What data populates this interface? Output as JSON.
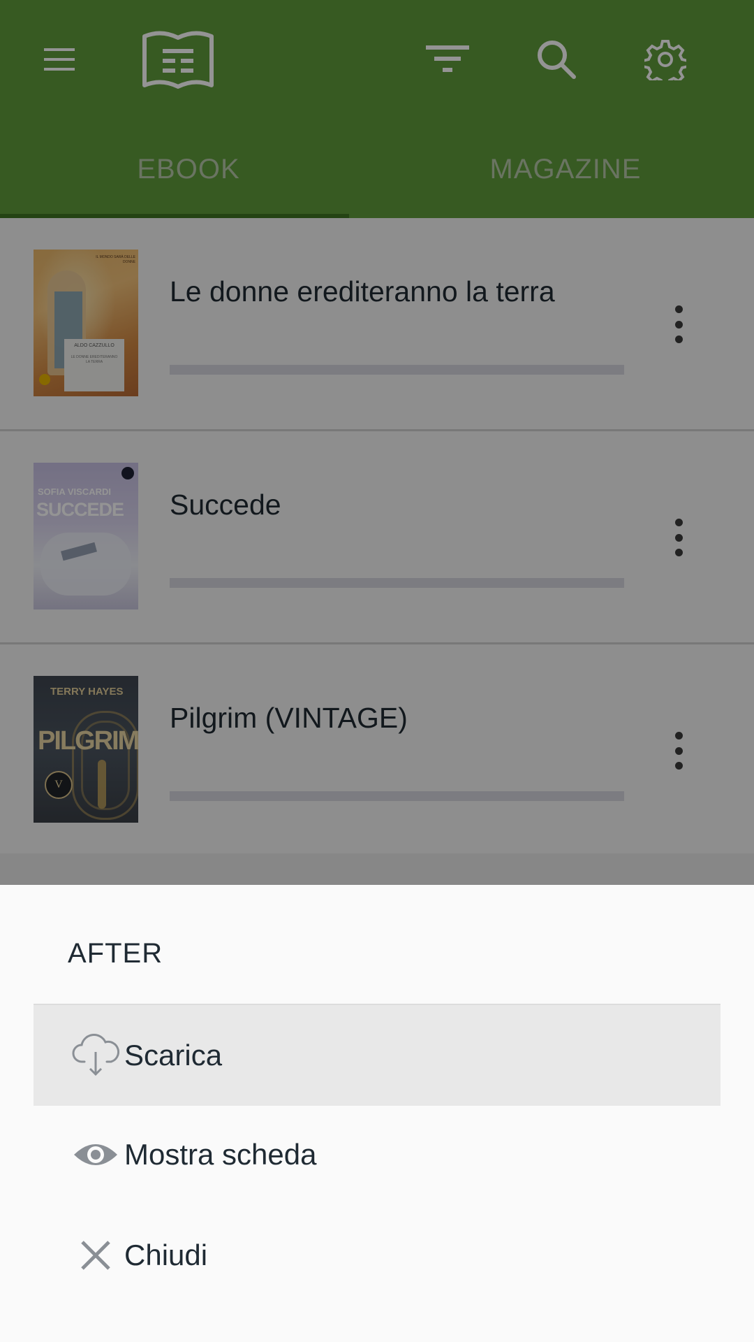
{
  "appbar": {
    "menu_icon": "hamburger-menu-icon",
    "logo_icon": "open-book-icon",
    "filter_icon": "filter-icon",
    "search_icon": "search-icon",
    "settings_icon": "gear-icon",
    "color": "#5f9c3b"
  },
  "tabs": [
    {
      "label": "EBOOK",
      "selected": true
    },
    {
      "label": "MAGAZINE",
      "selected": false
    }
  ],
  "books": [
    {
      "title": "Le donne erediteranno la terra",
      "progress": 0,
      "cover": {
        "author": "ALDO CAZZULLO",
        "small": "LE DONNE EREDITERANNO LA TERRA",
        "tag": "IL MONDO SARÀ DELLE DONNE"
      }
    },
    {
      "title": "Succede",
      "progress": 0,
      "cover": {
        "author": "SOFIA VISCARDI",
        "big": "SUCCEDE"
      }
    },
    {
      "title": "Pilgrim (VINTAGE)",
      "progress": 0,
      "cover": {
        "author": "TERRY HAYES",
        "big": "PILGRIM",
        "badge": "V"
      }
    }
  ],
  "sheet": {
    "title": "AFTER",
    "items": [
      {
        "label": "Scarica",
        "icon": "cloud-download-icon",
        "highlighted": true
      },
      {
        "label": "Mostra scheda",
        "icon": "eye-icon",
        "highlighted": false
      },
      {
        "label": "Chiudi",
        "icon": "close-icon",
        "highlighted": false
      }
    ]
  }
}
